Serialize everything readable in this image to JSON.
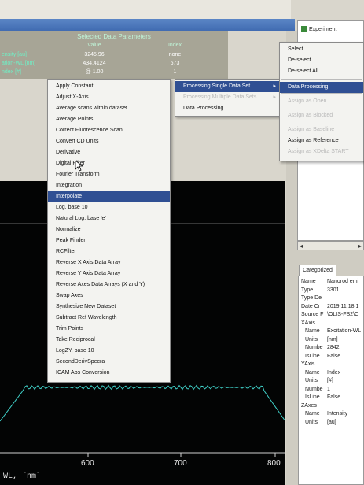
{
  "window": {
    "title": ""
  },
  "parameters": {
    "title": "Selected Data Parameters",
    "columns": [
      "Value",
      "Index"
    ],
    "rows": [
      {
        "name": "ensity [au]",
        "value": "3245.96",
        "index": "none"
      },
      {
        "name": "ation-WL [nm]",
        "value": "434.4124",
        "index": "673"
      },
      {
        "name": "ndex [#]",
        "value": "@ 1.00",
        "index": "1"
      }
    ]
  },
  "tree": {
    "item": "Experiment"
  },
  "select_menu": {
    "items": [
      {
        "label": "Select",
        "state": "normal"
      },
      {
        "label": "De-select",
        "state": "normal"
      },
      {
        "label": "De-select All",
        "state": "normal"
      },
      {
        "label": "Data Processing",
        "state": "selected"
      },
      {
        "label": "Assign as Open",
        "state": "disabled"
      },
      {
        "label": "Assign as Blocked",
        "state": "disabled"
      },
      {
        "label": "Assign as Baseline",
        "state": "disabled"
      },
      {
        "label": "Assign as Reference",
        "state": "normal"
      },
      {
        "label": "Assign as XDelta START",
        "state": "disabled"
      }
    ]
  },
  "processing_menu": {
    "items": [
      {
        "label": "Processing Single Data Set",
        "state": "selected",
        "submenu": true
      },
      {
        "label": "Processing Multiple Data Sets",
        "state": "disabled",
        "submenu": true
      },
      {
        "label": "Data Processing",
        "state": "normal",
        "submenu": false
      }
    ],
    "arrow_glyph": "▸"
  },
  "main_menu": {
    "selected_index": 10,
    "items": [
      "Apply Constant",
      "Adjust X-Axis",
      "Average scans within dataset",
      "Average Points",
      "Correct Fluorescence Scan",
      "Convert CD Units",
      "Derivative",
      "Digital Filter",
      "Fourier Transform",
      "Integration",
      "Interpolate",
      "Log, base 10",
      "Natural Log, base 'e'",
      "Normalize",
      "Peak Finder",
      "RCFilter",
      "Reverse X Axis Data Array",
      "Reverse Y Axis Data Array",
      "Reverse Axes Data Arrays (X and Y)",
      "Swap Axes",
      "Synthesize New Dataset",
      "Subtract Ref Wavelength",
      "Trim Points",
      "Take Reciprocal",
      "LogZY, base 10",
      "SecondDerivSpecra",
      "ICAM Abs Conversion"
    ]
  },
  "tab": {
    "label": "Categorized"
  },
  "properties": [
    {
      "key": "Name",
      "value": "Nanorod emi",
      "indent": false
    },
    {
      "key": "Type",
      "value": "3301",
      "indent": false
    },
    {
      "key": "Type De",
      "value": "",
      "indent": false
    },
    {
      "key": "Date Cr",
      "value": "2019.11.18 1",
      "indent": false
    },
    {
      "key": "Source F",
      "value": "\\OLIS-FS2\\C",
      "indent": false
    },
    {
      "key": "XAxis",
      "value": "",
      "indent": false
    },
    {
      "key": "Name",
      "value": "Excitation-WL",
      "indent": true
    },
    {
      "key": "Units",
      "value": "[nm]",
      "indent": true
    },
    {
      "key": "Numbe",
      "value": "2842",
      "indent": true
    },
    {
      "key": "IsLine",
      "value": "False",
      "indent": true
    },
    {
      "key": "YAxis",
      "value": "",
      "indent": false
    },
    {
      "key": "Name",
      "value": "Index",
      "indent": true
    },
    {
      "key": "Units",
      "value": "[#]",
      "indent": true
    },
    {
      "key": "Numbe",
      "value": "1",
      "indent": true
    },
    {
      "key": "IsLine",
      "value": "False",
      "indent": true
    },
    {
      "key": "ZAxes",
      "value": "",
      "indent": false
    },
    {
      "key": "Name",
      "value": "Intensity",
      "indent": true
    },
    {
      "key": "Units",
      "value": "[au]",
      "indent": true
    }
  ],
  "plot": {
    "x_ticks": [
      "600",
      "700",
      "800"
    ],
    "x_title": "WL, [nm]",
    "trace_color": "#3fd0c8",
    "background": "#030404"
  }
}
